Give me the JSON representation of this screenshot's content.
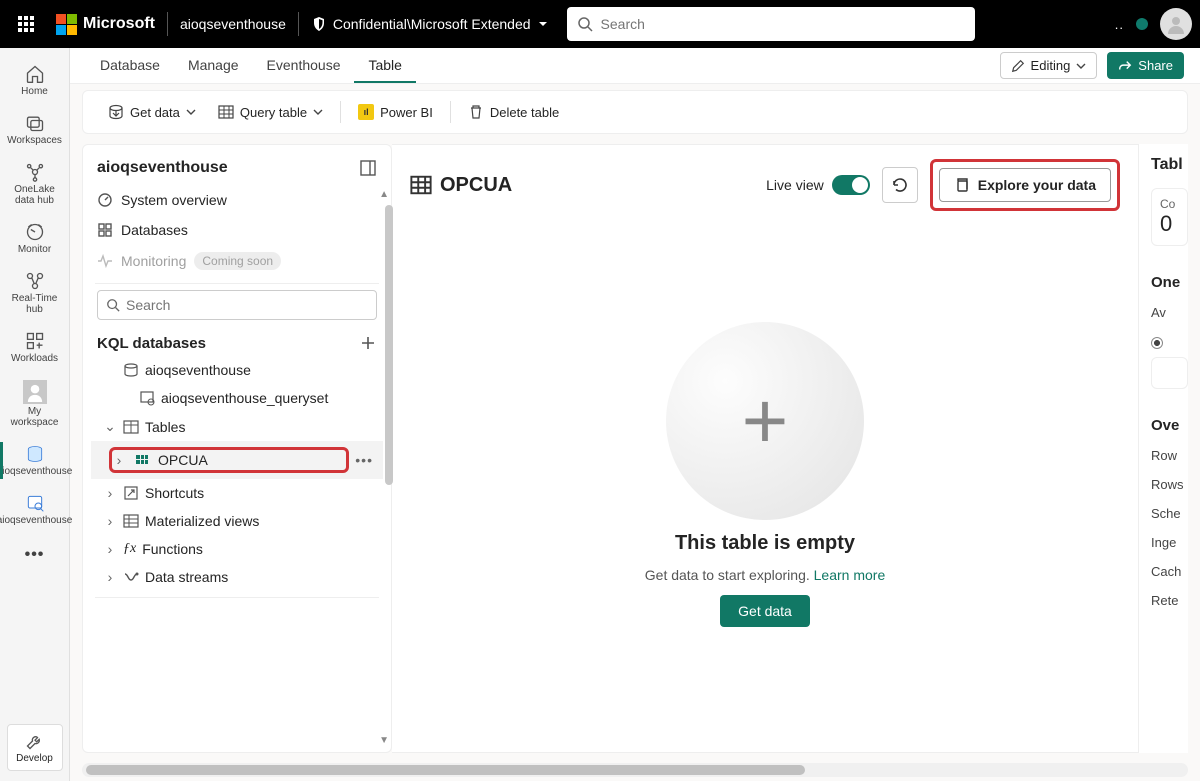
{
  "header": {
    "brand": "Microsoft",
    "breadcrumb": "aioqseventhouse",
    "classification": "Confidential\\Microsoft Extended",
    "search_placeholder": "Search"
  },
  "left_rail": [
    {
      "label": "Home"
    },
    {
      "label": "Workspaces"
    },
    {
      "label": "OneLake data hub"
    },
    {
      "label": "Monitor"
    },
    {
      "label": "Real-Time hub"
    },
    {
      "label": "Workloads"
    },
    {
      "label": "My workspace"
    },
    {
      "label": "aioqseventhouse"
    },
    {
      "label": "aioqseventhouse"
    }
  ],
  "left_rail_more": "•••",
  "left_rail_develop": "Develop",
  "tabs": {
    "items": [
      "Database",
      "Manage",
      "Eventhouse",
      "Table"
    ],
    "edit_label": "Editing",
    "share_label": "Share"
  },
  "toolbar": {
    "get_data": "Get data",
    "query_table": "Query table",
    "power_bi": "Power BI",
    "delete_table": "Delete table"
  },
  "tree": {
    "title": "aioqseventhouse",
    "system_overview": "System overview",
    "databases": "Databases",
    "monitoring": "Monitoring",
    "coming_soon": "Coming soon",
    "search_placeholder": "Search",
    "section_label": "KQL databases",
    "db_name": "aioqseventhouse",
    "queryset": "aioqseventhouse_queryset",
    "nodes": {
      "tables": "Tables",
      "opcua": "OPCUA",
      "shortcuts": "Shortcuts",
      "materialized": "Materialized views",
      "functions": "Functions",
      "datastreams": "Data streams"
    }
  },
  "main": {
    "title": "OPCUA",
    "live_view": "Live view",
    "explore": "Explore your data",
    "empty_title": "This table is empty",
    "empty_sub": "Get data to start exploring.",
    "learn_more": "Learn more",
    "get_data_btn": "Get data"
  },
  "details": {
    "title_tab": "Tabl",
    "compressed_label": "Co",
    "compressed_value": "0",
    "onelake_title": "One",
    "availability": "Av",
    "overview_title": "Ove",
    "rows": [
      "Row",
      "Rows",
      "Sche",
      "Inge",
      "Cach",
      "Rete"
    ]
  }
}
